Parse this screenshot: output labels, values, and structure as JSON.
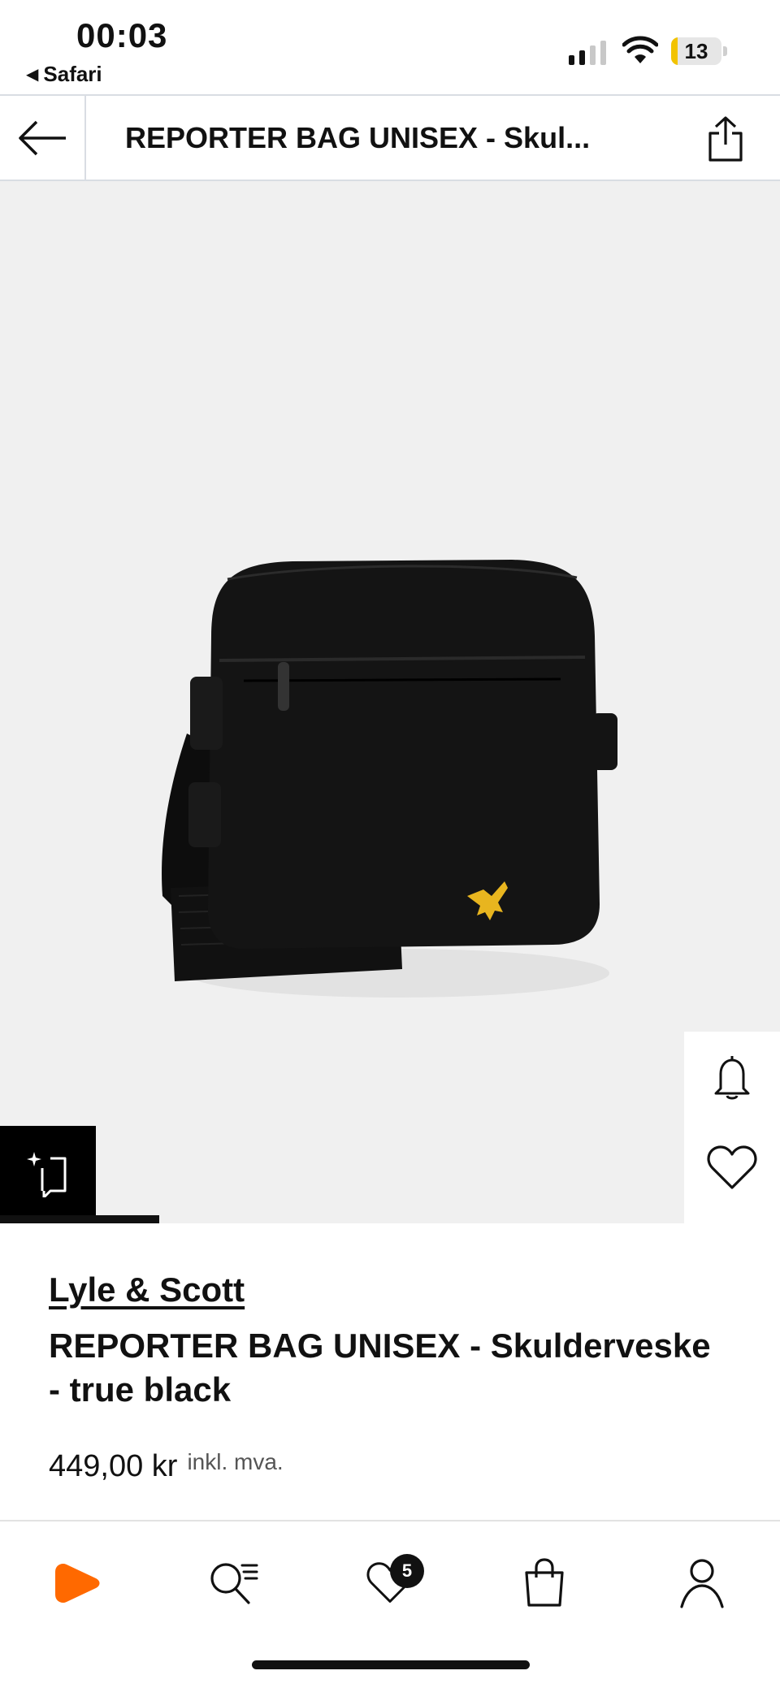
{
  "status_bar": {
    "time": "00:03",
    "back_app": "Safari",
    "battery_level": "13",
    "battery_fraction": 0.13,
    "battery_color": "#f2c300",
    "signal_bars": {
      "total": 4,
      "active": 2
    }
  },
  "header": {
    "title": "REPORTER BAG UNISEX - Skul...",
    "back_icon": "arrow-left-icon",
    "share_icon": "share-icon"
  },
  "product": {
    "brand": "Lyle & Scott",
    "name": "REPORTER BAG UNISEX - Skulderveske - true black",
    "price": "449,00 kr",
    "vat_note": "inkl. mva.",
    "logo_color": "#e8b51f",
    "image_progress_fraction": 0.2
  },
  "side_actions": {
    "notify_icon": "bell-icon",
    "wishlist_icon": "heart-icon",
    "similar_icon": "similar-items-icon"
  },
  "bottom_nav": {
    "items": [
      {
        "name": "home",
        "icon": "zalando-logo-icon",
        "color": "#ff6900"
      },
      {
        "name": "search",
        "icon": "search-icon"
      },
      {
        "name": "wishlist",
        "icon": "heart-icon",
        "badge": "5"
      },
      {
        "name": "bag",
        "icon": "shopping-bag-icon"
      },
      {
        "name": "profile",
        "icon": "user-icon"
      }
    ]
  }
}
